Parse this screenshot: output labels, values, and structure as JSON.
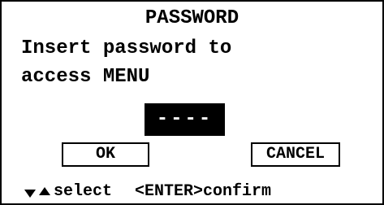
{
  "dialog": {
    "title": "PASSWORD",
    "message_line1": "Insert password to",
    "message_line2": "access MENU"
  },
  "password_field": {
    "value": "----"
  },
  "buttons": {
    "ok_label": "OK",
    "cancel_label": "CANCEL"
  },
  "footer": {
    "select_icons": [
      "arrow-down-icon",
      "arrow-up-icon"
    ],
    "select_label": "select",
    "confirm_label": "<ENTER>confirm"
  },
  "colors": {
    "background": "#ffffff",
    "foreground": "#000000",
    "field_background": "#000000",
    "field_text": "#ffffff"
  }
}
